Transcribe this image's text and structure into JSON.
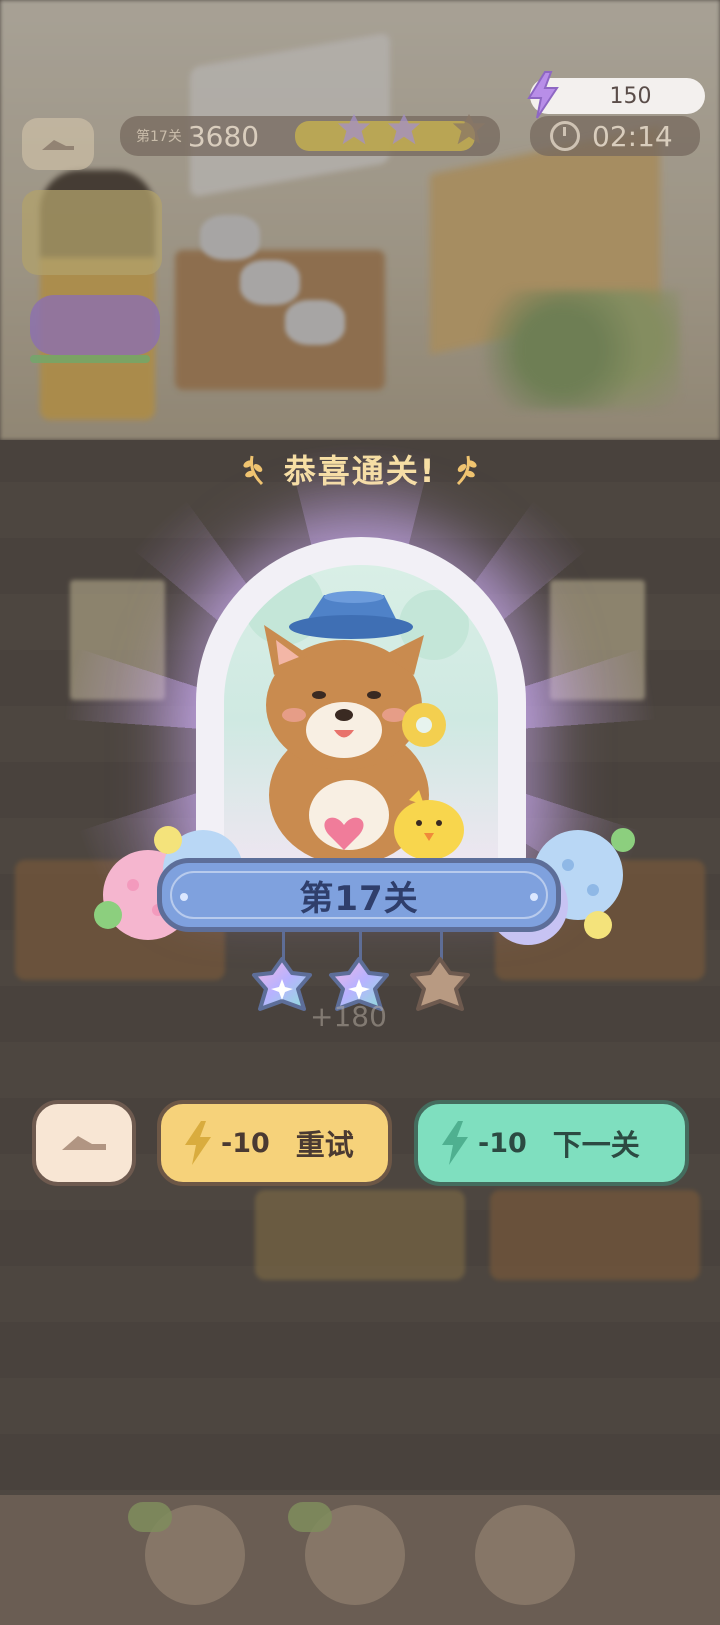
{
  "hud": {
    "level_label": "第17关",
    "score": "3680",
    "energy": "150",
    "timer": "02:14"
  },
  "result": {
    "title": "恭喜通关!",
    "level": "第17关",
    "stars_earned": 2,
    "stars_total": 3,
    "bonus_text": "+180"
  },
  "buttons": {
    "home_icon": "home-icon",
    "retry_cost": "-10",
    "retry_label": "重试",
    "next_cost": "-10",
    "next_label": "下一关"
  },
  "colors": {
    "retry_button": "#f6d27a",
    "next_button": "#7fdfbf",
    "level_banner": "#7fa1de",
    "title_text": "#f7dfa4",
    "star_earned": "#c8b6ff",
    "star_empty": "#b89a82"
  }
}
